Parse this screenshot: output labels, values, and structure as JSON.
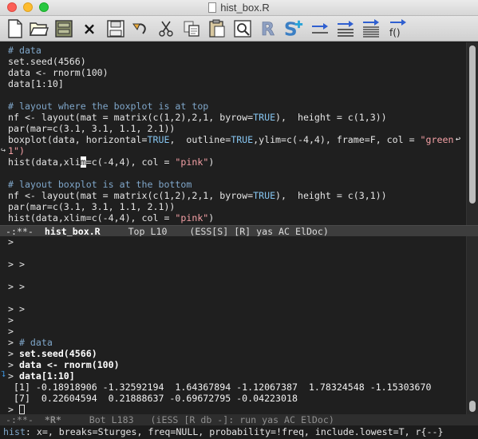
{
  "window": {
    "title": "hist_box.R"
  },
  "toolbar": {
    "buttons": [
      {
        "name": "new-file-icon",
        "label": "New"
      },
      {
        "name": "open-folder-icon",
        "label": "Open"
      },
      {
        "name": "save-drawer-icon",
        "label": "Dired"
      },
      {
        "name": "close-icon",
        "label": "Close"
      },
      {
        "name": "floppy-save-icon",
        "label": "Save"
      },
      {
        "name": "undo-icon",
        "label": "Undo"
      },
      {
        "name": "cut-icon",
        "label": "Cut"
      },
      {
        "name": "copy-icon",
        "label": "Copy"
      },
      {
        "name": "paste-icon",
        "label": "Paste"
      },
      {
        "name": "search-icon",
        "label": "Search"
      },
      {
        "name": "r-logo-icon",
        "label": "R"
      },
      {
        "name": "s-logo-icon",
        "label": "S"
      },
      {
        "name": "eval-line-icon",
        "label": "Eval line"
      },
      {
        "name": "eval-region-icon",
        "label": "Eval region"
      },
      {
        "name": "eval-buffer-icon",
        "label": "Eval buffer"
      },
      {
        "name": "eval-function-icon",
        "label": "f()"
      }
    ],
    "close_glyph": "×",
    "func_label": "f()"
  },
  "editor": {
    "lines": [
      {
        "type": "comment",
        "text": "# data"
      },
      {
        "type": "code",
        "text": "set.seed(4566)"
      },
      {
        "type": "code",
        "text": "data <- rnorm(100)"
      },
      {
        "type": "code",
        "text": "data[1:10]"
      },
      {
        "type": "blank",
        "text": ""
      },
      {
        "type": "comment",
        "text": "# layout where the boxplot is at top"
      },
      {
        "type": "code",
        "text": "nf <- layout(mat = matrix(c(1,2),2,1, byrow=TRUE),  height = c(1,3))"
      },
      {
        "type": "code",
        "text": "par(mar=c(3.1, 3.1, 1.1, 2.1))"
      },
      {
        "type": "code",
        "text": "boxplot(data, horizontal=TRUE,  outline=TRUE,ylim=c(-4,4), frame=F, col = \"green"
      },
      {
        "type": "code",
        "text": "1\")"
      },
      {
        "type": "code",
        "text": "hist(data,xlim=c(-4,4), col = \"pink\")"
      },
      {
        "type": "blank",
        "text": ""
      },
      {
        "type": "comment",
        "text": "# layout boxplot is at the bottom"
      },
      {
        "type": "code",
        "text": "nf <- layout(mat = matrix(c(1,2),2,1, byrow=TRUE),  height = c(3,1))"
      },
      {
        "type": "code",
        "text": "par(mar=c(3.1, 3.1, 1.1, 2.1))"
      },
      {
        "type": "code",
        "text": "hist(data,xlim=c(-4,4), col = \"pink\")"
      }
    ]
  },
  "modeline_top": {
    "status": "-:**-",
    "buffer": "hist_box.R",
    "position": "Top L10",
    "modes": "(ESS[S] [R] yas AC ElDoc)"
  },
  "console": {
    "lines": [
      {
        "type": "prompt",
        "text": ">"
      },
      {
        "type": "blank",
        "text": ""
      },
      {
        "type": "prompt",
        "text": "> >"
      },
      {
        "type": "blank",
        "text": ""
      },
      {
        "type": "prompt",
        "text": "> >"
      },
      {
        "type": "blank",
        "text": ""
      },
      {
        "type": "prompt",
        "text": "> >"
      },
      {
        "type": "prompt",
        "text": ">"
      },
      {
        "type": "prompt",
        "text": ">"
      },
      {
        "type": "input",
        "prompt": "> ",
        "text": "# data"
      },
      {
        "type": "input",
        "prompt": "> ",
        "text": "set.seed(4566)"
      },
      {
        "type": "input",
        "prompt": "> ",
        "text": "data <- rnorm(100)"
      },
      {
        "type": "input",
        "prompt": "> ",
        "text": "data[1:10]"
      },
      {
        "type": "output",
        "text": " [1] -0.18918906 -1.32592194  1.64367894 -1.12067387  1.78324548 -1.15303670"
      },
      {
        "type": "output",
        "text": " [7]  0.22604594  0.21888637 -0.69672795 -0.04223018"
      },
      {
        "type": "prompt",
        "text": "> "
      }
    ]
  },
  "modeline_bottom": {
    "status": "-:**-",
    "buffer": "*R*",
    "position": "Bot L183",
    "modes": "(iESS [R db -]: run yas AC ElDoc)"
  },
  "echo_area": {
    "func": "hist",
    "text": ": x=, breaks=Sturges, freq=NULL, probability=!freq, include.lowest=T, r{--}"
  },
  "colors": {
    "comment": "#7fa6c9",
    "string": "#f4a0a5",
    "constant": "#86c5f0",
    "background": "#1f1f1f"
  }
}
